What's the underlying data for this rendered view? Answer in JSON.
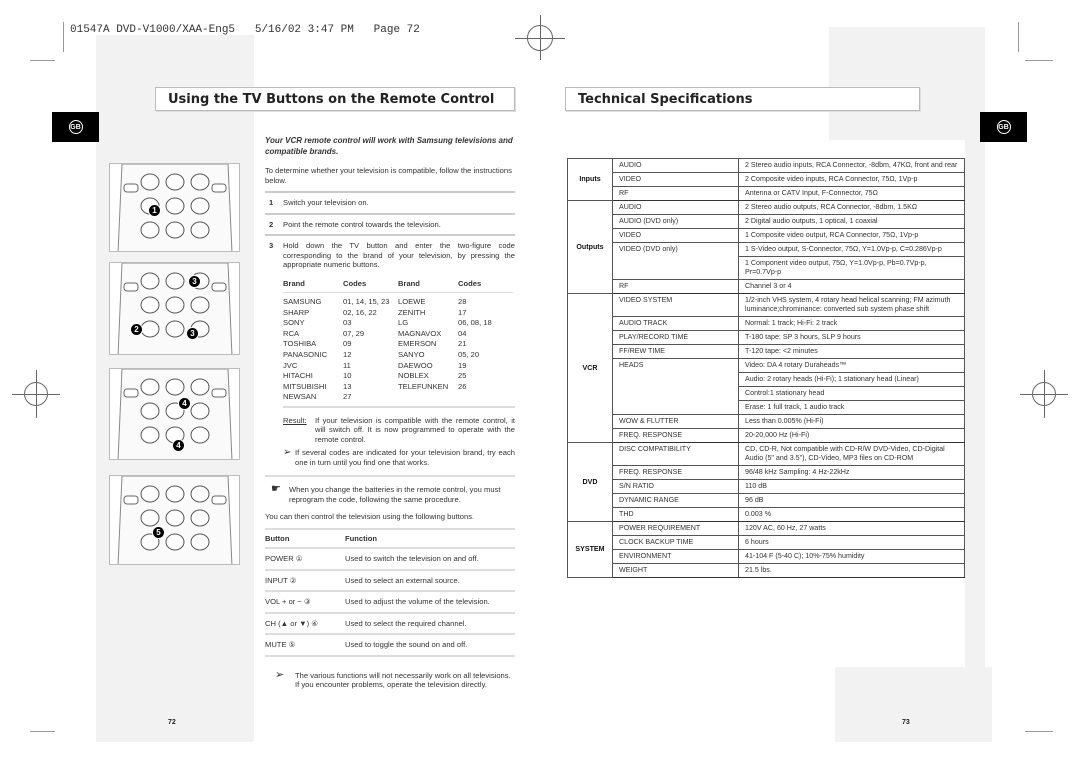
{
  "slug": "01547A DVD-V1000/XAA-Eng5   5/16/02 3:47 PM   Page 72",
  "left": {
    "title": "Using the TV Buttons on the Remote Control",
    "badge": "GB",
    "intro": "Your VCR remote control will work with Samsung televisions and compatible brands.",
    "lead": "To determine whether your television is compatible, follow the instructions below.",
    "steps": [
      {
        "n": "1",
        "text": "Switch your television on."
      },
      {
        "n": "2",
        "text": "Point the remote control towards the television."
      },
      {
        "n": "3",
        "text": "Hold down the TV button and enter the two-figure code corresponding to the brand of your television, by pressing the appropriate numeric buttons."
      }
    ],
    "brand_headers": [
      "Brand",
      "Codes",
      "Brand",
      "Codes"
    ],
    "brands": [
      [
        "SAMSUNG",
        "01, 14, 15, 23",
        "LOEWE",
        "28"
      ],
      [
        "SHARP",
        "02, 16, 22",
        "ZENITH",
        "17"
      ],
      [
        "SONY",
        "03",
        "LG",
        "06, 08, 18"
      ],
      [
        "RCA",
        "07, 29",
        "MAGNAVOX",
        "04"
      ],
      [
        "TOSHIBA",
        "09",
        "EMERSON",
        "21"
      ],
      [
        "PANASONIC",
        "12",
        "SANYO",
        "05, 20"
      ],
      [
        "JVC",
        "11",
        "DAEWOO",
        "19"
      ],
      [
        "HITACHI",
        "10",
        "NOBLEX",
        "25"
      ],
      [
        "MITSUBISHI",
        "13",
        "TELEFUNKEN",
        "26"
      ],
      [
        "NEWSAN",
        "27",
        "",
        ""
      ]
    ],
    "result_label": "Result:",
    "result_text": "If your television is compatible with the remote control, it will switch off. It is now programmed to operate with the remote control.",
    "tip1": "If several codes are indicated for your television brand, try each one in turn until you find one that works.",
    "note": "When you change the batteries in the remote control, you must reprogram the code, following the same procedure.",
    "then": "You can then control the television using the following buttons.",
    "func_headers": [
      "Button",
      "Function"
    ],
    "functions": [
      [
        "POWER ①",
        "Used to switch the television on and off."
      ],
      [
        "INPUT ②",
        "Used to select an external source."
      ],
      [
        "VOL + or − ③",
        "Used to adjust the volume of the television."
      ],
      [
        "CH (▲ or ▼) ④",
        "Used to select the required channel."
      ],
      [
        "MUTE ⑤",
        "Used to toggle the sound on and off."
      ]
    ],
    "tip2": "The various functions will not necessarily work on all televisions. If you encounter problems, operate the television directly.",
    "page_number": "72",
    "remote_callouts": [
      "1",
      "3",
      "2",
      "3",
      "4",
      "4",
      "5"
    ]
  },
  "right": {
    "title": "Technical Specifications",
    "badge": "GB",
    "page_number": "73",
    "specs": [
      {
        "group": "Inputs",
        "items": [
          {
            "name": "AUDIO",
            "values": [
              "2 Stereo audio inputs, RCA Connector, -8dbm, 47KΩ, front and rear"
            ]
          },
          {
            "name": "VIDEO",
            "values": [
              "2 Composite video inputs, RCA Connector, 75Ω, 1Vp-p"
            ]
          },
          {
            "name": "RF",
            "values": [
              "Antenna or CATV Input, F-Connector, 75Ω"
            ]
          }
        ]
      },
      {
        "group": "Outputs",
        "items": [
          {
            "name": "AUDIO",
            "values": [
              "2 Stereo audio outputs, RCA Connector, -8dbm, 1.5KΩ"
            ]
          },
          {
            "name": "AUDIO (DVD only)",
            "values": [
              "2 Digital audio outputs, 1 optical, 1 coaxial"
            ]
          },
          {
            "name": "VIDEO",
            "values": [
              "1 Composite video output, RCA Connector, 75Ω, 1Vp-p"
            ]
          },
          {
            "name": "VIDEO (DVD only)",
            "values": [
              "1 S-Video output, S-Connector, 75Ω, Y=1.0Vp-p, C=0.286Vp-p",
              "1 Component video output, 75Ω, Y=1.0Vp-p, Pb=0.7Vp-p, Pr=0.7Vp-p"
            ]
          },
          {
            "name": "RF",
            "values": [
              "Channel 3 or 4"
            ]
          }
        ]
      },
      {
        "group": "VCR",
        "items": [
          {
            "name": "VIDEO SYSTEM",
            "values": [
              "1/2-inch VHS system, 4 rotary head helical scanning; FM azimuth luminance;chrominance: converted sub system phase shift"
            ]
          },
          {
            "name": "AUDIO TRACK",
            "values": [
              "Normal: 1 track; Hi-Fi: 2 track"
            ]
          },
          {
            "name": "PLAY/RECORD TIME",
            "values": [
              "T-180 tape: SP 3 hours, SLP 9 hours"
            ]
          },
          {
            "name": "FF/REW TIME",
            "values": [
              "T-120 tape: <2 minutes"
            ]
          },
          {
            "name": "HEADS",
            "values": [
              "Video:  DA 4 rotary Duraheads™",
              "Audio:  2 rotary heads (Hi-Fi); 1 stationary head (Linear)",
              "Control:1 stationary head",
              "Erase:  1 full track, 1 audio track"
            ]
          },
          {
            "name": "WOW & FLUTTER",
            "values": [
              "Less than 0.005% (Hi-Fi)"
            ]
          },
          {
            "name": "FREQ. RESPONSE",
            "values": [
              "20-20,000 Hz (Hi-Fi)"
            ]
          }
        ]
      },
      {
        "group": "DVD",
        "items": [
          {
            "name": "DISC COMPATIBILITY",
            "values": [
              "CD, CD-R, Not compatible with CD-R/W DVD-Video, CD-Digital Audio (5\" and 3.5\"), CD-Video, MP3 files on CD-ROM"
            ]
          },
          {
            "name": "FREQ. RESPONSE",
            "values": [
              "96/48 kHz Sampling: 4 Hz-22kHz"
            ]
          },
          {
            "name": "S/N RATIO",
            "values": [
              "110 dB"
            ]
          },
          {
            "name": "DYNAMIC RANGE",
            "values": [
              "96 dB"
            ]
          },
          {
            "name": "THD",
            "values": [
              "0.003 %"
            ]
          }
        ]
      },
      {
        "group": "SYSTEM",
        "items": [
          {
            "name": "POWER REQUIREMENT",
            "values": [
              "120V AC, 60 Hz, 27 watts"
            ]
          },
          {
            "name": "CLOCK BACKUP TIME",
            "values": [
              "6 hours"
            ]
          },
          {
            "name": "ENVIRONMENT",
            "values": [
              "41-104 F (5-40 C); 10%-75% humidity"
            ]
          },
          {
            "name": "WEIGHT",
            "values": [
              "21.5 lbs."
            ]
          }
        ]
      }
    ]
  }
}
